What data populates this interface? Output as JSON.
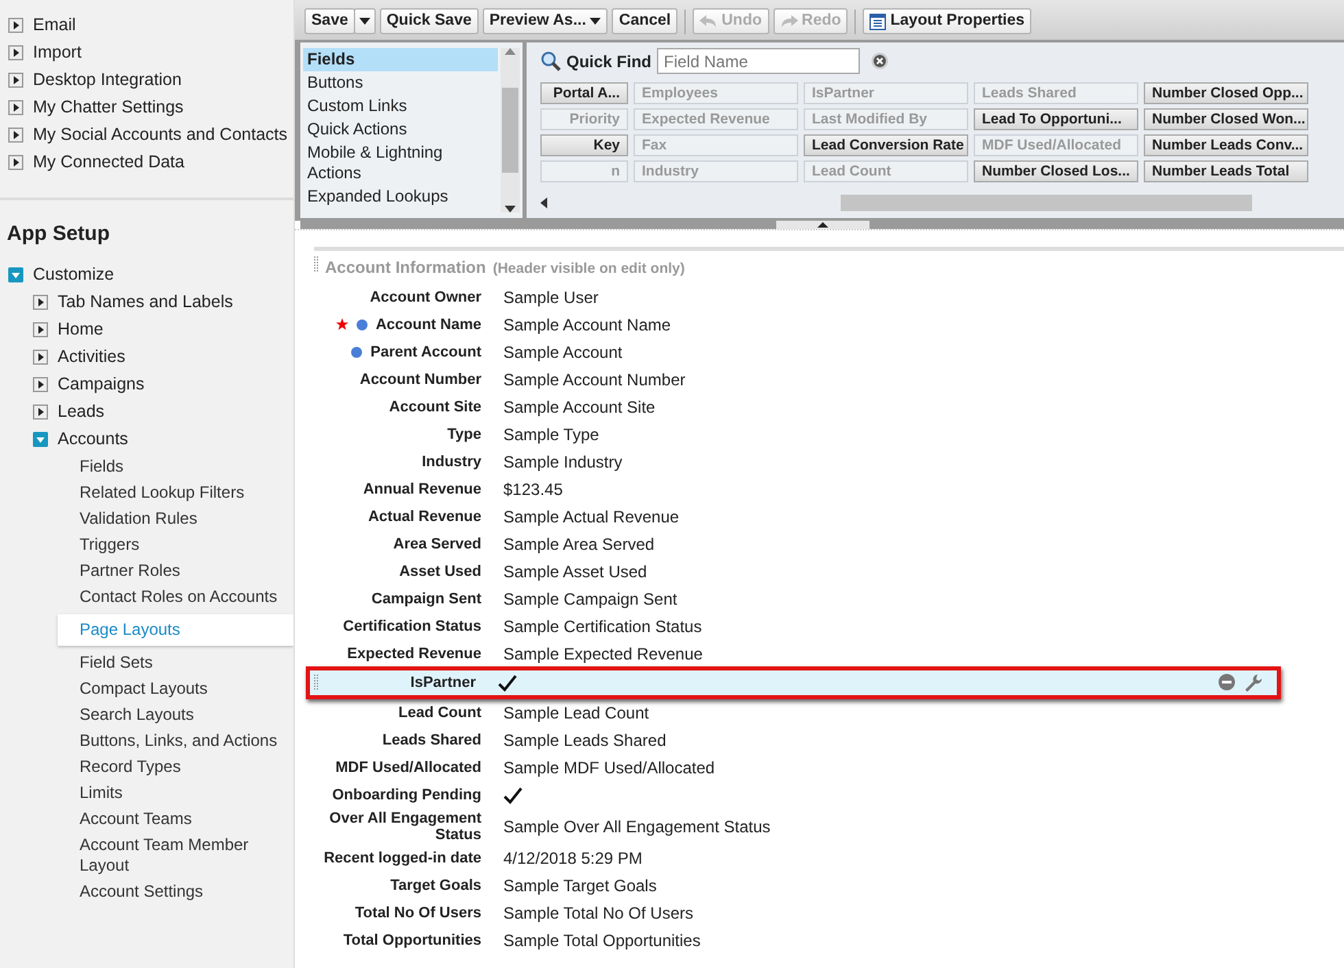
{
  "sidebar": {
    "personal_items": [
      {
        "label": "Email",
        "expanded": false
      },
      {
        "label": "Import",
        "expanded": false
      },
      {
        "label": "Desktop Integration",
        "expanded": false
      },
      {
        "label": "My Chatter Settings",
        "expanded": false
      },
      {
        "label": "My Social Accounts and Contacts",
        "expanded": false
      },
      {
        "label": "My Connected Data",
        "expanded": false
      }
    ],
    "app_setup": {
      "title": "App Setup",
      "items": [
        {
          "label": "Customize",
          "expanded": true,
          "children": [
            {
              "label": "Tab Names and Labels",
              "expanded": false
            },
            {
              "label": "Home",
              "expanded": false
            },
            {
              "label": "Activities",
              "expanded": false
            },
            {
              "label": "Campaigns",
              "expanded": false
            },
            {
              "label": "Leads",
              "expanded": false
            },
            {
              "label": "Accounts",
              "expanded": true,
              "children": [
                {
                  "label": "Fields",
                  "selected": false
                },
                {
                  "label": "Related Lookup Filters",
                  "selected": false
                },
                {
                  "label": "Validation Rules",
                  "selected": false
                },
                {
                  "label": "Triggers",
                  "selected": false
                },
                {
                  "label": "Partner Roles",
                  "selected": false
                },
                {
                  "label": "Contact Roles on Accounts",
                  "selected": false
                },
                {
                  "label": "Page Layouts",
                  "selected": true
                },
                {
                  "label": "Field Sets",
                  "selected": false
                },
                {
                  "label": "Compact Layouts",
                  "selected": false
                },
                {
                  "label": "Search Layouts",
                  "selected": false
                },
                {
                  "label": "Buttons, Links, and Actions",
                  "selected": false
                },
                {
                  "label": "Record Types",
                  "selected": false
                },
                {
                  "label": "Limits",
                  "selected": false
                },
                {
                  "label": "Account Teams",
                  "selected": false
                },
                {
                  "label": "Account Team Member Layout",
                  "selected": false
                },
                {
                  "label": "Account Settings",
                  "selected": false
                }
              ]
            }
          ]
        }
      ]
    }
  },
  "toolbar": {
    "buttons": [
      {
        "label": "Save",
        "kind": "split",
        "disabled": false
      },
      {
        "label": "Quick Save",
        "kind": "plain",
        "disabled": false
      },
      {
        "label": "Preview As...",
        "kind": "menu",
        "disabled": false
      },
      {
        "label": "Cancel",
        "kind": "plain",
        "disabled": false
      },
      {
        "label": "Undo",
        "kind": "undo",
        "disabled": true
      },
      {
        "label": "Redo",
        "kind": "redo",
        "disabled": true
      },
      {
        "label": "Layout Properties",
        "kind": "properties",
        "disabled": false
      }
    ]
  },
  "palette": {
    "categories": [
      {
        "label": "Fields",
        "selected": true
      },
      {
        "label": "Buttons",
        "selected": false
      },
      {
        "label": "Custom Links",
        "selected": false
      },
      {
        "label": "Quick Actions",
        "selected": false
      },
      {
        "label": "Mobile & Lightning Actions",
        "selected": false
      },
      {
        "label": "Expanded Lookups",
        "selected": false
      }
    ],
    "quick_find": {
      "label": "Quick Find",
      "placeholder": "Field Name"
    },
    "rows": [
      [
        {
          "label": "Portal A...",
          "used": false
        },
        {
          "label": "Employees",
          "used": true
        },
        {
          "label": "IsPartner",
          "used": true
        },
        {
          "label": "Leads Shared",
          "used": true
        },
        {
          "label": "Number Closed Opp...",
          "used": false
        }
      ],
      [
        {
          "label": "Priority",
          "used": true
        },
        {
          "label": "Expected Revenue",
          "used": true
        },
        {
          "label": "Last Modified By",
          "used": true
        },
        {
          "label": "Lead To Opportuni...",
          "used": false
        },
        {
          "label": "Number Closed Won...",
          "used": false
        }
      ],
      [
        {
          "label": "Key",
          "used": false
        },
        {
          "label": "Fax",
          "used": true
        },
        {
          "label": "Lead Conversion Rate",
          "used": false
        },
        {
          "label": "MDF Used/Allocated",
          "used": true
        },
        {
          "label": "Number Leads Conv...",
          "used": false
        }
      ],
      [
        {
          "label": "n",
          "used": true
        },
        {
          "label": "Industry",
          "used": true
        },
        {
          "label": "Lead Count",
          "used": true
        },
        {
          "label": "Number Closed Los...",
          "used": false
        },
        {
          "label": "Number Leads Total",
          "used": false
        }
      ]
    ]
  },
  "section": {
    "title": "Account Information",
    "note": "(Header visible on edit only)",
    "fields": [
      {
        "label": "Account Owner",
        "kind": "link",
        "value": "Sample User",
        "required": false,
        "marker": false,
        "selected": false
      },
      {
        "label": "Account Name",
        "kind": "text",
        "value": "Sample Account Name",
        "required": true,
        "marker": true,
        "selected": false
      },
      {
        "label": "Parent Account",
        "kind": "link",
        "value": "Sample Account",
        "required": false,
        "marker": true,
        "selected": false
      },
      {
        "label": "Account Number",
        "kind": "text",
        "value": "Sample Account Number",
        "required": false,
        "marker": false,
        "selected": false
      },
      {
        "label": "Account Site",
        "kind": "text",
        "value": "Sample Account Site",
        "required": false,
        "marker": false,
        "selected": false
      },
      {
        "label": "Type",
        "kind": "text",
        "value": "Sample Type",
        "required": false,
        "marker": false,
        "selected": false
      },
      {
        "label": "Industry",
        "kind": "text",
        "value": "Sample Industry",
        "required": false,
        "marker": false,
        "selected": false
      },
      {
        "label": "Annual Revenue",
        "kind": "text",
        "value": "$123.45",
        "required": false,
        "marker": false,
        "selected": false
      },
      {
        "label": "Actual Revenue",
        "kind": "text",
        "value": "Sample Actual Revenue",
        "required": false,
        "marker": false,
        "selected": false
      },
      {
        "label": "Area Served",
        "kind": "text",
        "value": "Sample Area Served",
        "required": false,
        "marker": false,
        "selected": false
      },
      {
        "label": "Asset Used",
        "kind": "text",
        "value": "Sample Asset Used",
        "required": false,
        "marker": false,
        "selected": false
      },
      {
        "label": "Campaign Sent",
        "kind": "text",
        "value": "Sample Campaign Sent",
        "required": false,
        "marker": false,
        "selected": false
      },
      {
        "label": "Certification Status",
        "kind": "text",
        "value": "Sample Certification Status",
        "required": false,
        "marker": false,
        "selected": false
      },
      {
        "label": "Expected Revenue",
        "kind": "text",
        "value": "Sample Expected Revenue",
        "required": false,
        "marker": false,
        "selected": false
      },
      {
        "label": "IsPartner",
        "kind": "check",
        "checked": true,
        "required": false,
        "marker": false,
        "selected": true
      },
      {
        "label": "Lead Count",
        "kind": "text",
        "value": "Sample Lead Count",
        "required": false,
        "marker": false,
        "selected": false
      },
      {
        "label": "Leads Shared",
        "kind": "text",
        "value": "Sample Leads Shared",
        "required": false,
        "marker": false,
        "selected": false
      },
      {
        "label": "MDF Used/Allocated",
        "kind": "text",
        "value": "Sample MDF Used/Allocated",
        "required": false,
        "marker": false,
        "selected": false
      },
      {
        "label": "Onboarding Pending",
        "kind": "check",
        "checked": true,
        "required": false,
        "marker": false,
        "selected": false
      },
      {
        "label": "Over All Engagement Status",
        "kind": "text",
        "value": "Sample Over All Engagement Status",
        "required": false,
        "marker": false,
        "selected": false
      },
      {
        "label": "Recent logged-in date",
        "kind": "text",
        "value": "4/12/2018 5:29 PM",
        "required": false,
        "marker": false,
        "selected": false
      },
      {
        "label": "Target Goals",
        "kind": "text",
        "value": "Sample Target Goals",
        "required": false,
        "marker": false,
        "selected": false
      },
      {
        "label": "Total No Of Users",
        "kind": "text",
        "value": "Sample Total No Of Users",
        "required": false,
        "marker": false,
        "selected": false
      },
      {
        "label": "Total Opportunities",
        "kind": "text",
        "value": "Sample Total Opportunities",
        "required": false,
        "marker": false,
        "selected": false
      }
    ]
  }
}
